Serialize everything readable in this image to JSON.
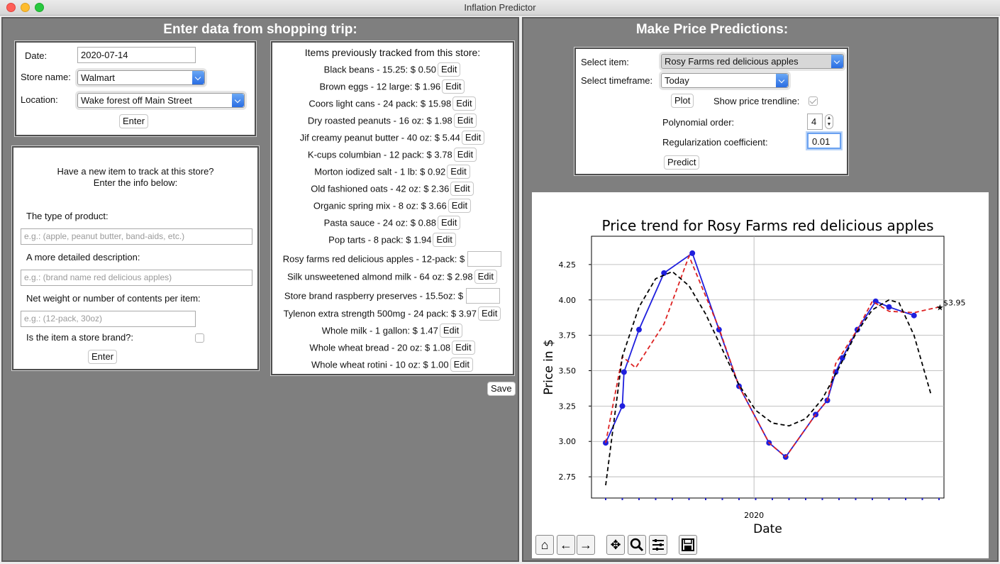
{
  "window": {
    "title": "Inflation Predictor"
  },
  "left": {
    "heading": "Enter data from shopping trip:",
    "trip": {
      "date_label": "Date:",
      "date_value": "2020-07-14",
      "store_label": "Store name:",
      "store_value": "Walmart",
      "location_label": "Location:",
      "location_value": "Wake forest off Main Street",
      "enter_label": "Enter"
    },
    "new_item": {
      "intro_line1": "Have a new item to track at this store?",
      "intro_line2": "Enter the info below:",
      "type_label": "The type of product:",
      "type_placeholder": "e.g.: (apple, peanut butter, band-aids, etc.)",
      "desc_label": "A more detailed description:",
      "desc_placeholder": "e.g.: (brand name red delicious apples)",
      "weight_label": "Net weight or number of contents per item:",
      "weight_placeholder": "e.g.: (12-pack, 30oz)",
      "store_brand_label": "Is the item a store brand?:",
      "store_brand_checked": false,
      "enter_label": "Enter"
    },
    "tracked": {
      "title": "Items previously tracked from this store:",
      "edit_label": "Edit",
      "items": [
        {
          "text": "Black beans  -  15.25: $  0.50",
          "editable": true
        },
        {
          "text": "Brown eggs  -  12 large: $  1.96",
          "editable": true
        },
        {
          "text": "Coors light cans  -  24 pack: $  15.98",
          "editable": true
        },
        {
          "text": "Dry roasted peanuts  -  16 oz: $  1.98",
          "editable": true
        },
        {
          "text": "Jif creamy peanut butter  -  40 oz: $  5.44",
          "editable": true
        },
        {
          "text": "K-cups columbian  -  12 pack: $  3.78",
          "editable": true
        },
        {
          "text": "Morton iodized salt  -  1 lb: $  0.92",
          "editable": true
        },
        {
          "text": "Old fashioned oats  -  42 oz: $  2.36",
          "editable": true
        },
        {
          "text": "Organic spring mix  -  8 oz: $  3.66",
          "editable": true
        },
        {
          "text": "Pasta sauce  -  24 oz: $  0.88",
          "editable": true
        },
        {
          "text": "Pop tarts  -  8 pack: $  1.94",
          "editable": true
        },
        {
          "text": "Rosy farms red delicious apples  -  12-pack: $",
          "editable": false
        },
        {
          "text": "Silk unsweetened almond milk  -  64 oz: $  2.98",
          "editable": true
        },
        {
          "text": "Store brand raspberry preserves  -  15.5oz: $",
          "editable": false
        },
        {
          "text": "Tylenon extra strength 500mg  -  24 pack: $  3.97",
          "editable": true
        },
        {
          "text": "Whole milk  -  1 gallon: $  1.47",
          "editable": true
        },
        {
          "text": "Whole wheat bread  -  20 oz: $  1.08",
          "editable": true
        },
        {
          "text": "Whole wheat rotini  -  10 oz: $  1.00",
          "editable": true
        }
      ],
      "save_label": "Save"
    }
  },
  "right": {
    "heading": "Make Price Predictions:",
    "controls": {
      "item_label": "Select item:",
      "item_value": "Rosy Farms red delicious apples",
      "timeframe_label": "Select timeframe:",
      "timeframe_value": "Today",
      "plot_label": "Plot",
      "trendline_label": "Show price trendline:",
      "trendline_checked": true,
      "poly_label": "Polynomial order:",
      "poly_value": "4",
      "reg_label": "Regularization coefficient:",
      "reg_value": "0.01",
      "predict_label": "Predict"
    },
    "toolbar": [
      "home-icon",
      "back-icon",
      "forward-icon",
      "pan-icon",
      "zoom-icon",
      "configure-icon",
      "save-icon"
    ]
  },
  "chart_data": {
    "type": "line",
    "title": "Price trend for Rosy Farms red delicious apples",
    "xlabel": "Date",
    "ylabel": "Price in $",
    "ylim": [
      2.6,
      4.45
    ],
    "yticks": [
      2.75,
      3.0,
      3.25,
      3.5,
      3.75,
      4.0,
      4.25
    ],
    "ytick_labels": [
      "2.75",
      "3.00",
      "3.25",
      "3.50",
      "3.75",
      "4.00",
      "4.25"
    ],
    "xtick_labels": [
      "2020"
    ],
    "x_index_range": [
      0,
      20
    ],
    "xtick_index": 8.9,
    "grid": true,
    "series": [
      {
        "style": "solid-blue-markers",
        "color": "#1f1fdd",
        "points": [
          [
            0,
            2.99
          ],
          [
            1,
            3.25
          ],
          [
            1.1,
            3.49
          ],
          [
            2,
            3.79
          ],
          [
            3.5,
            4.19
          ],
          [
            5.2,
            4.33
          ],
          [
            6.8,
            3.79
          ],
          [
            8,
            3.39
          ],
          [
            9.8,
            2.99
          ],
          [
            10.8,
            2.89
          ],
          [
            12.6,
            3.19
          ],
          [
            13.3,
            3.29
          ],
          [
            13.8,
            3.49
          ],
          [
            14.2,
            3.59
          ],
          [
            15.1,
            3.79
          ],
          [
            16.2,
            3.99
          ],
          [
            17,
            3.95
          ],
          [
            18.5,
            3.89
          ]
        ]
      },
      {
        "style": "dashed-red",
        "color": "#dd2222",
        "points": [
          [
            0,
            2.99
          ],
          [
            1,
            3.6
          ],
          [
            1.8,
            3.52
          ],
          [
            3.5,
            3.83
          ],
          [
            5,
            4.31
          ],
          [
            6.8,
            3.8
          ],
          [
            8,
            3.39
          ],
          [
            9.8,
            2.99
          ],
          [
            10.8,
            2.89
          ],
          [
            12.6,
            3.19
          ],
          [
            13.3,
            3.29
          ],
          [
            13.8,
            3.55
          ],
          [
            15.1,
            3.79
          ],
          [
            16,
            3.99
          ],
          [
            17,
            3.92
          ],
          [
            18.5,
            3.91
          ],
          [
            20,
            3.95
          ]
        ]
      },
      {
        "style": "dashed-black",
        "color": "#000000",
        "points": [
          [
            0,
            2.69
          ],
          [
            1,
            3.6
          ],
          [
            2,
            3.95
          ],
          [
            3,
            4.15
          ],
          [
            4,
            4.2
          ],
          [
            5,
            4.1
          ],
          [
            6,
            3.9
          ],
          [
            7,
            3.65
          ],
          [
            8,
            3.4
          ],
          [
            9,
            3.22
          ],
          [
            10,
            3.13
          ],
          [
            11,
            3.11
          ],
          [
            12,
            3.16
          ],
          [
            13,
            3.3
          ],
          [
            14,
            3.52
          ],
          [
            15,
            3.76
          ],
          [
            16,
            3.93
          ],
          [
            17,
            4.0
          ],
          [
            17.6,
            3.98
          ],
          [
            18.5,
            3.75
          ],
          [
            19.5,
            3.34
          ]
        ]
      }
    ],
    "annotation": {
      "x": 20,
      "y": 3.95,
      "text": "$3.95"
    }
  }
}
